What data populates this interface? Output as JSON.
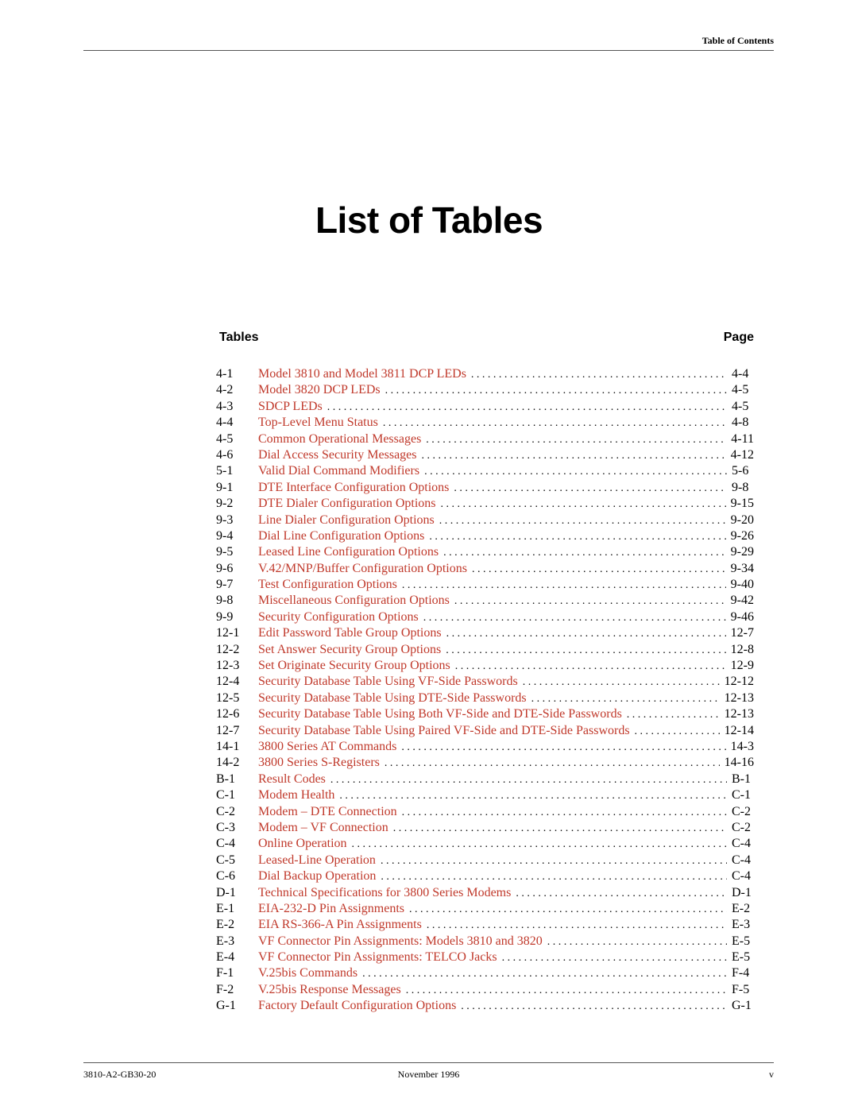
{
  "header": {
    "title": "Table of Contents"
  },
  "page_title": "List of Tables",
  "columns": {
    "tables": "Tables",
    "page": "Page"
  },
  "colors": {
    "link": "#c0392b",
    "text": "#000000"
  },
  "entries": [
    {
      "num": "4-1",
      "title": "Model 3810 and Model 3811 DCP LEDs",
      "page": "4-4"
    },
    {
      "num": "4-2",
      "title": "Model 3820 DCP LEDs",
      "page": "4-5"
    },
    {
      "num": "4-3",
      "title": "SDCP LEDs",
      "page": "4-5"
    },
    {
      "num": "4-4",
      "title": "Top-Level Menu Status",
      "page": "4-8"
    },
    {
      "num": "4-5",
      "title": "Common Operational Messages",
      "page": "4-11"
    },
    {
      "num": "4-6",
      "title": "Dial Access Security Messages",
      "page": "4-12"
    },
    {
      "num": "5-1",
      "title": "Valid Dial Command Modifiers",
      "page": "5-6"
    },
    {
      "num": "9-1",
      "title": "DTE Interface Configuration Options",
      "page": "9-8"
    },
    {
      "num": "9-2",
      "title": "DTE Dialer Configuration Options",
      "page": "9-15"
    },
    {
      "num": "9-3",
      "title": "Line Dialer Configuration Options",
      "page": "9-20"
    },
    {
      "num": "9-4",
      "title": "Dial Line Configuration Options",
      "page": "9-26"
    },
    {
      "num": "9-5",
      "title": "Leased Line Configuration Options",
      "page": "9-29"
    },
    {
      "num": "9-6",
      "title": "V.42/MNP/Buffer Configuration Options",
      "page": "9-34"
    },
    {
      "num": "9-7",
      "title": "Test Configuration Options",
      "page": "9-40"
    },
    {
      "num": "9-8",
      "title": "Miscellaneous Configuration Options",
      "page": "9-42"
    },
    {
      "num": "9-9",
      "title": "Security Configuration Options",
      "page": "9-46"
    },
    {
      "num": "12-1",
      "title": "Edit Password Table Group Options",
      "page": "12-7"
    },
    {
      "num": "12-2",
      "title": "Set Answer Security Group Options",
      "page": "12-8"
    },
    {
      "num": "12-3",
      "title": "Set Originate Security Group Options",
      "page": "12-9"
    },
    {
      "num": "12-4",
      "title": "Security Database Table Using VF-Side Passwords",
      "page": "12-12"
    },
    {
      "num": "12-5",
      "title": "Security Database Table Using DTE-Side Passwords",
      "page": "12-13"
    },
    {
      "num": "12-6",
      "title": "Security Database Table Using Both VF-Side and DTE-Side Passwords",
      "page": "12-13"
    },
    {
      "num": "12-7",
      "title": "Security Database Table Using Paired VF-Side and DTE-Side Passwords",
      "page": "12-14"
    },
    {
      "num": "14-1",
      "title": "3800 Series AT Commands",
      "page": "14-3"
    },
    {
      "num": "14-2",
      "title": "3800 Series S-Registers",
      "page": "14-16"
    },
    {
      "num": "B-1",
      "title": "Result Codes",
      "page": "B-1"
    },
    {
      "num": "C-1",
      "title": "Modem Health",
      "page": "C-1"
    },
    {
      "num": "C-2",
      "title": "Modem – DTE Connection",
      "page": "C-2"
    },
    {
      "num": "C-3",
      "title": "Modem – VF Connection",
      "page": "C-2"
    },
    {
      "num": "C-4",
      "title": "Online Operation",
      "page": "C-4"
    },
    {
      "num": "C-5",
      "title": "Leased-Line Operation",
      "page": "C-4"
    },
    {
      "num": "C-6",
      "title": "Dial Backup Operation",
      "page": "C-4"
    },
    {
      "num": "D-1",
      "title": "Technical Specifications for 3800 Series Modems",
      "page": "D-1"
    },
    {
      "num": "E-1",
      "title": "EIA-232-D Pin Assignments",
      "page": "E-2"
    },
    {
      "num": "E-2",
      "title": "EIA RS-366-A Pin Assignments",
      "page": "E-3"
    },
    {
      "num": "E-3",
      "title": "VF Connector Pin Assignments: Models 3810 and 3820",
      "page": "E-5"
    },
    {
      "num": "E-4",
      "title": "VF Connector Pin Assignments: TELCO Jacks",
      "page": "E-5"
    },
    {
      "num": "F-1",
      "title": "V.25bis Commands",
      "page": "F-4"
    },
    {
      "num": "F-2",
      "title": "V.25bis Response Messages",
      "page": "F-5"
    },
    {
      "num": "G-1",
      "title": "Factory Default Configuration Options",
      "page": "G-1"
    }
  ],
  "footer": {
    "doc_number": "3810-A2-GB30-20",
    "date": "November 1996",
    "page": "v"
  }
}
